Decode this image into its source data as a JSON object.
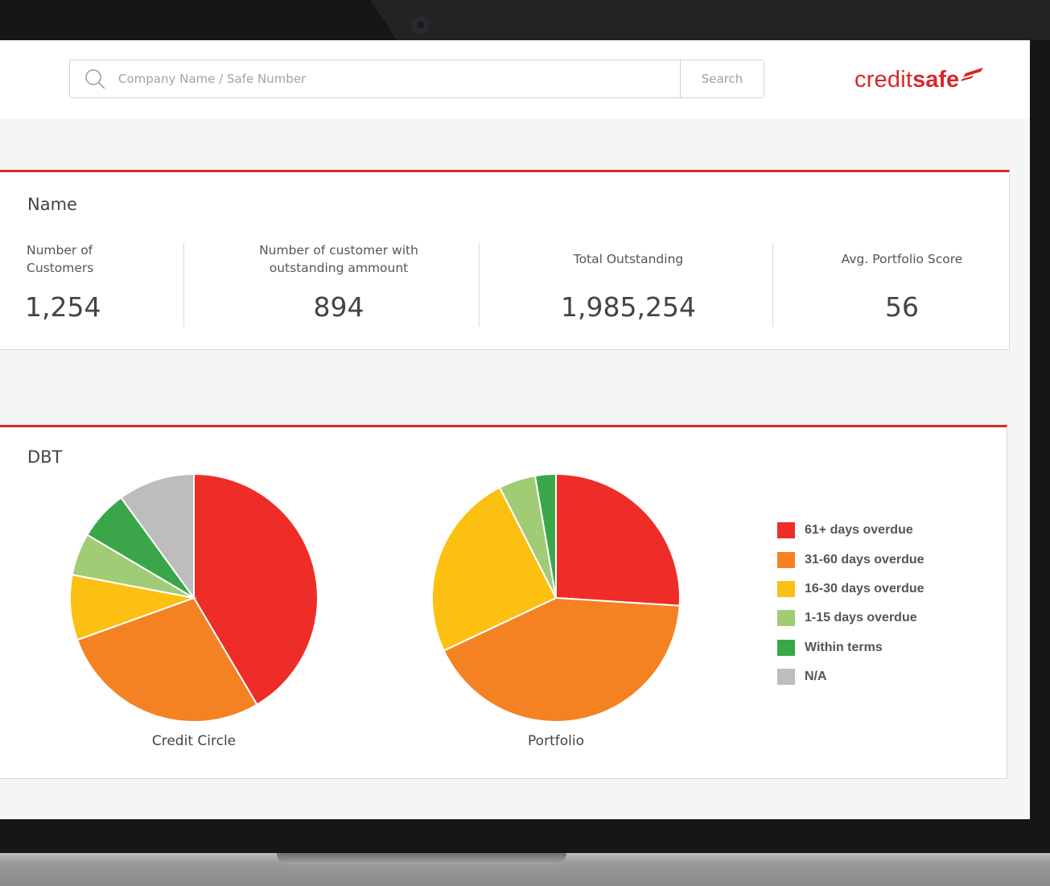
{
  "search": {
    "placeholder": "Company Name / Safe Number",
    "button_label": "Search"
  },
  "logo": {
    "light": "credit",
    "bold": "safe",
    "color": "#d8262b"
  },
  "summary": {
    "title": "Name",
    "kpis": [
      {
        "label_line1": "Number of",
        "label_line2": "Customers",
        "value": "1,254"
      },
      {
        "label_line1": "Number of customer with",
        "label_line2": "outstanding ammount",
        "value": "894"
      },
      {
        "label_line1": "Total Outstanding",
        "label_line2": "",
        "value": "1,985,254"
      },
      {
        "label_line1": "Avg. Portfolio Score",
        "label_line2": "",
        "value": "56"
      }
    ]
  },
  "dbt": {
    "title": "DBT",
    "legend": [
      {
        "label": "61+ days overdue",
        "color": "#ee2d28"
      },
      {
        "label": "31-60 days overdue",
        "color": "#f48222"
      },
      {
        "label": "16-30 days overdue",
        "color": "#fcc012"
      },
      {
        "label": "1-15 days overdue",
        "color": "#a1cc76"
      },
      {
        "label": "Within terms",
        "color": "#3ba649"
      },
      {
        "label": "N/A",
        "color": "#bdbdbd"
      }
    ]
  },
  "chart_data": [
    {
      "type": "pie",
      "title": "Credit Circle",
      "categories": [
        "61+ days overdue",
        "31-60 days overdue",
        "16-30 days overdue",
        "1-15 days overdue",
        "Within terms",
        "N/A"
      ],
      "values": [
        41.5,
        28,
        8.5,
        5.5,
        6.5,
        10
      ]
    },
    {
      "type": "pie",
      "title": "Portfolio",
      "categories": [
        "61+ days overdue",
        "31-60 days overdue",
        "16-30 days overdue",
        "1-15 days overdue",
        "Within terms"
      ],
      "values": [
        26,
        42,
        24.5,
        4.8,
        2.7
      ]
    }
  ]
}
